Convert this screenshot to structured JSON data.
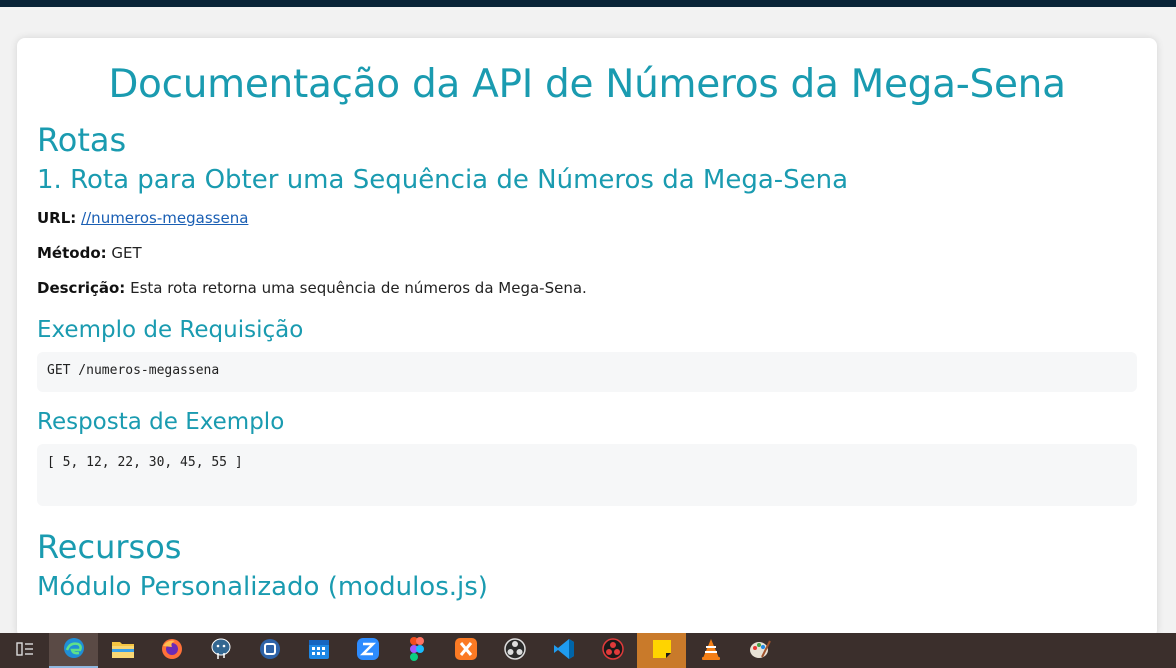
{
  "doc": {
    "title": "Documentação da API de Números da Mega-Sena",
    "routes_heading": "Rotas",
    "route1_heading": "1. Rota para Obter uma Sequência de Números da Mega-Sena",
    "url_label": "URL:",
    "url_value": "//numeros-megassena",
    "method_label": "Método:",
    "method_value": "GET",
    "description_label": "Descrição:",
    "description_value": "Esta rota retorna uma sequência de números da Mega-Sena.",
    "request_example_heading": "Exemplo de Requisição",
    "request_example_code": "GET /numeros-megassena",
    "response_example_heading": "Resposta de Exemplo",
    "response_example_code": "[ 5, 12, 22, 30, 45, 55 ]",
    "resources_heading": "Recursos",
    "module_heading": "Módulo Personalizado (modulos.js)"
  },
  "taskbar": {
    "icons": [
      "task-view-icon",
      "edge-icon",
      "file-explorer-icon",
      "firefox-icon",
      "postgresql-icon",
      "virtualbox-icon",
      "calendar-icon",
      "zoom-icon",
      "figma-icon",
      "xampp-icon",
      "obs-icon",
      "vscode-icon",
      "davinci-icon",
      "sticky-notes-icon",
      "vlc-icon",
      "paint-icon"
    ],
    "colors": {
      "edge": "#1f8fd6",
      "explorer": "#f4c542",
      "firefox": "#ff7139",
      "postgresql": "#336791",
      "virtualbox": "#2f63a8",
      "calendar": "#1e88e5",
      "zoom": "#2d8cff",
      "xampp": "#fb7a24",
      "vscode": "#1f9cf0",
      "sticky": "#ffd400",
      "vlc": "#f47f16"
    }
  }
}
